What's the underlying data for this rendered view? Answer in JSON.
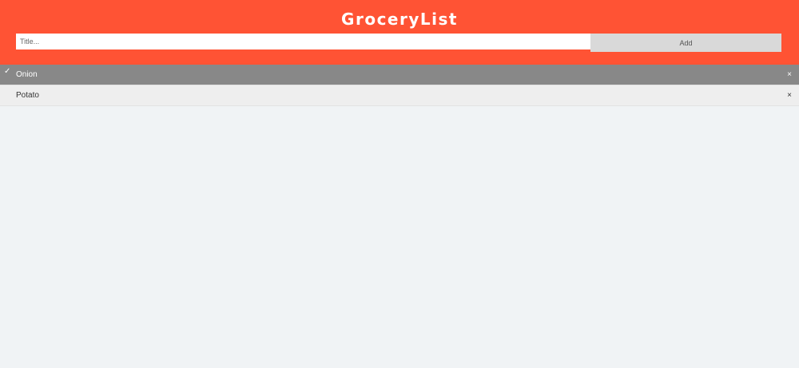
{
  "header": {
    "title": "GroceryList",
    "input_placeholder": "Title...",
    "input_value": "",
    "add_label": "Add",
    "background_color": "#ff5334"
  },
  "items": [
    {
      "label": "Onion",
      "checked": true,
      "check_icon": "checkmark-icon",
      "close_glyph": "×",
      "close_icon": "close-icon"
    },
    {
      "label": "Potato",
      "checked": false,
      "close_glyph": "×",
      "close_icon": "close-icon"
    }
  ],
  "colors": {
    "checked_row": "#888888",
    "unchecked_row": "#eeeeee",
    "page_background": "#f0f3f5"
  }
}
